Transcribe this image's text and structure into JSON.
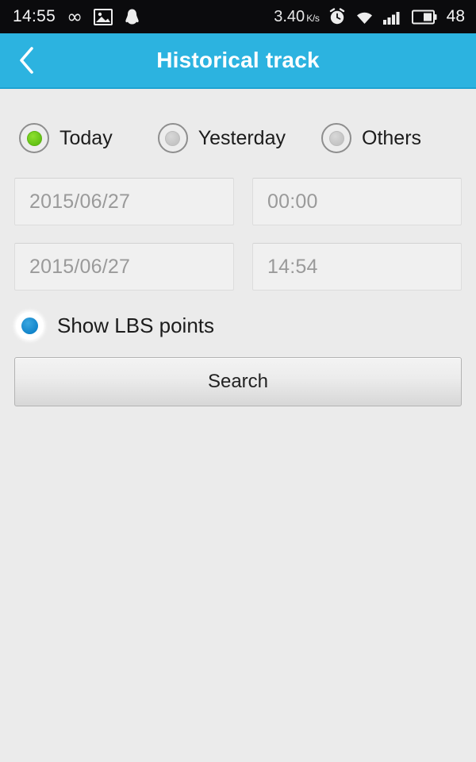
{
  "status_bar": {
    "clock": "14:55",
    "net_speed_value": "3.40",
    "net_speed_unit": "K/s",
    "battery_percent": "48",
    "icons": [
      "infinity-icon",
      "image-icon",
      "qq-icon",
      "alarm-clock-icon",
      "wifi-icon",
      "signal-bars-icon",
      "battery-icon"
    ]
  },
  "header": {
    "back_icon": "chevron-left-icon",
    "title": "Historical track"
  },
  "range_options": {
    "items": [
      {
        "label": "Today",
        "selected": true
      },
      {
        "label": "Yesterday",
        "selected": false
      },
      {
        "label": "Others",
        "selected": false
      }
    ]
  },
  "fields": {
    "start_date": {
      "value": "2015/06/27",
      "placeholder": "2015/06/27"
    },
    "start_time": {
      "value": "00:00",
      "placeholder": "00:00"
    },
    "end_date": {
      "value": "2015/06/27",
      "placeholder": "2015/06/27"
    },
    "end_time": {
      "value": "14:54",
      "placeholder": "14:54"
    }
  },
  "lbs_checkbox": {
    "label": "Show LBS points",
    "checked": true
  },
  "search_button": {
    "label": "Search"
  },
  "colors": {
    "header_blue": "#2cb3e0",
    "header_blue_border": "#1ea3d2",
    "body_gray": "#ebebeb",
    "radio_green": "#6ec81e",
    "checkbox_blue": "#1b8fd4",
    "status_black": "#0b0b0d"
  }
}
